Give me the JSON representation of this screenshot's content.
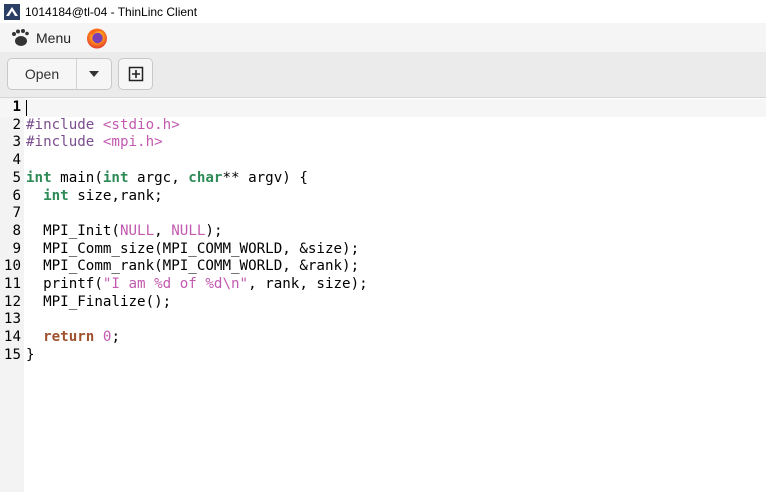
{
  "window": {
    "title": "1014184@tl-04 - ThinLinc Client"
  },
  "panel": {
    "menu_label": "Menu"
  },
  "toolbar": {
    "open_label": "Open"
  },
  "editor": {
    "current_line": 1,
    "lines": [
      {
        "n": "1",
        "code": ""
      },
      {
        "n": "2",
        "code": "#include <stdio.h>"
      },
      {
        "n": "3",
        "code": "#include <mpi.h>"
      },
      {
        "n": "4",
        "code": ""
      },
      {
        "n": "5",
        "code": "int main(int argc, char** argv) {"
      },
      {
        "n": "6",
        "code": "  int size,rank;"
      },
      {
        "n": "7",
        "code": ""
      },
      {
        "n": "8",
        "code": "  MPI_Init(NULL, NULL);"
      },
      {
        "n": "9",
        "code": "  MPI_Comm_size(MPI_COMM_WORLD, &size);"
      },
      {
        "n": "10",
        "code": "  MPI_Comm_rank(MPI_COMM_WORLD, &rank);"
      },
      {
        "n": "11",
        "code": "  printf(\"I am %d of %d\\n\", rank, size);"
      },
      {
        "n": "12",
        "code": "  MPI_Finalize();"
      },
      {
        "n": "13",
        "code": ""
      },
      {
        "n": "14",
        "code": "  return 0;"
      },
      {
        "n": "15",
        "code": "}"
      }
    ]
  }
}
